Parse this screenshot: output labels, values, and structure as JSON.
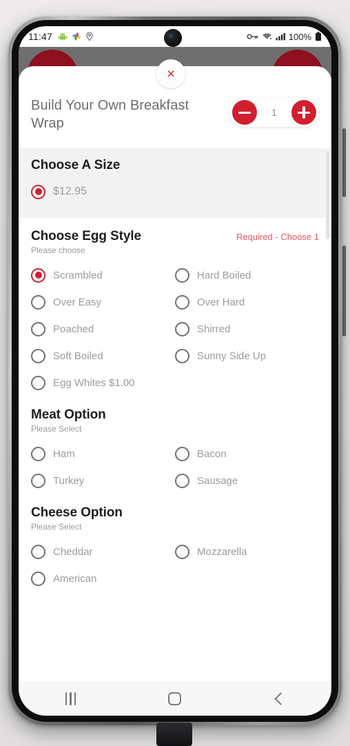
{
  "status_bar": {
    "time": "11:47",
    "left_icons": [
      "android-icon",
      "photos-icon",
      "location-pin-icon"
    ],
    "right_icons": [
      "vpn-key-icon",
      "wifi-icon",
      "signal-bars-icon"
    ],
    "battery_text": "100%"
  },
  "sheet": {
    "close_label": "×",
    "item_title": "Build Your Own Breakfast Wrap",
    "quantity": "1",
    "minus_label": "−",
    "plus_label": "+"
  },
  "groups": [
    {
      "title": "Choose A Size",
      "subtitle": "",
      "required_note": "",
      "style": "size",
      "options": [
        {
          "label": "$12.95",
          "selected": true,
          "full": true
        }
      ]
    },
    {
      "title": "Choose Egg Style",
      "subtitle": "Please choose",
      "required_note": "Required - Choose 1",
      "style": "plain",
      "options": [
        {
          "label": "Scrambled",
          "selected": true,
          "full": false
        },
        {
          "label": "Hard Boiled",
          "selected": false,
          "full": false
        },
        {
          "label": "Over Easy",
          "selected": false,
          "full": false
        },
        {
          "label": "Over Hard",
          "selected": false,
          "full": false
        },
        {
          "label": "Poached",
          "selected": false,
          "full": false
        },
        {
          "label": "Shirred",
          "selected": false,
          "full": false
        },
        {
          "label": "Soft Boiled",
          "selected": false,
          "full": false
        },
        {
          "label": "Sunny Side Up",
          "selected": false,
          "full": false
        },
        {
          "label": "Egg Whites $1.00",
          "selected": false,
          "full": false
        }
      ]
    },
    {
      "title": "Meat Option",
      "subtitle": "Please Select",
      "required_note": "",
      "style": "plain",
      "options": [
        {
          "label": "Ham",
          "selected": false,
          "full": false
        },
        {
          "label": "Bacon",
          "selected": false,
          "full": false
        },
        {
          "label": "Turkey",
          "selected": false,
          "full": false
        },
        {
          "label": "Sausage",
          "selected": false,
          "full": false
        }
      ]
    },
    {
      "title": "Cheese Option",
      "subtitle": "Please Select",
      "required_note": "",
      "style": "plain",
      "options": [
        {
          "label": "Cheddar",
          "selected": false,
          "full": false
        },
        {
          "label": "Mozzarella",
          "selected": false,
          "full": false
        },
        {
          "label": "American",
          "selected": false,
          "full": false
        }
      ]
    }
  ],
  "nav_bar": {
    "recents_label": "recents-icon",
    "home_label": "home-icon",
    "back_label": "back-icon"
  },
  "colors": {
    "accent_red": "#d0202f",
    "required_red": "#e8545a",
    "backdrop_gray": "#6f6f6f",
    "size_band": "#f2f2f2"
  }
}
